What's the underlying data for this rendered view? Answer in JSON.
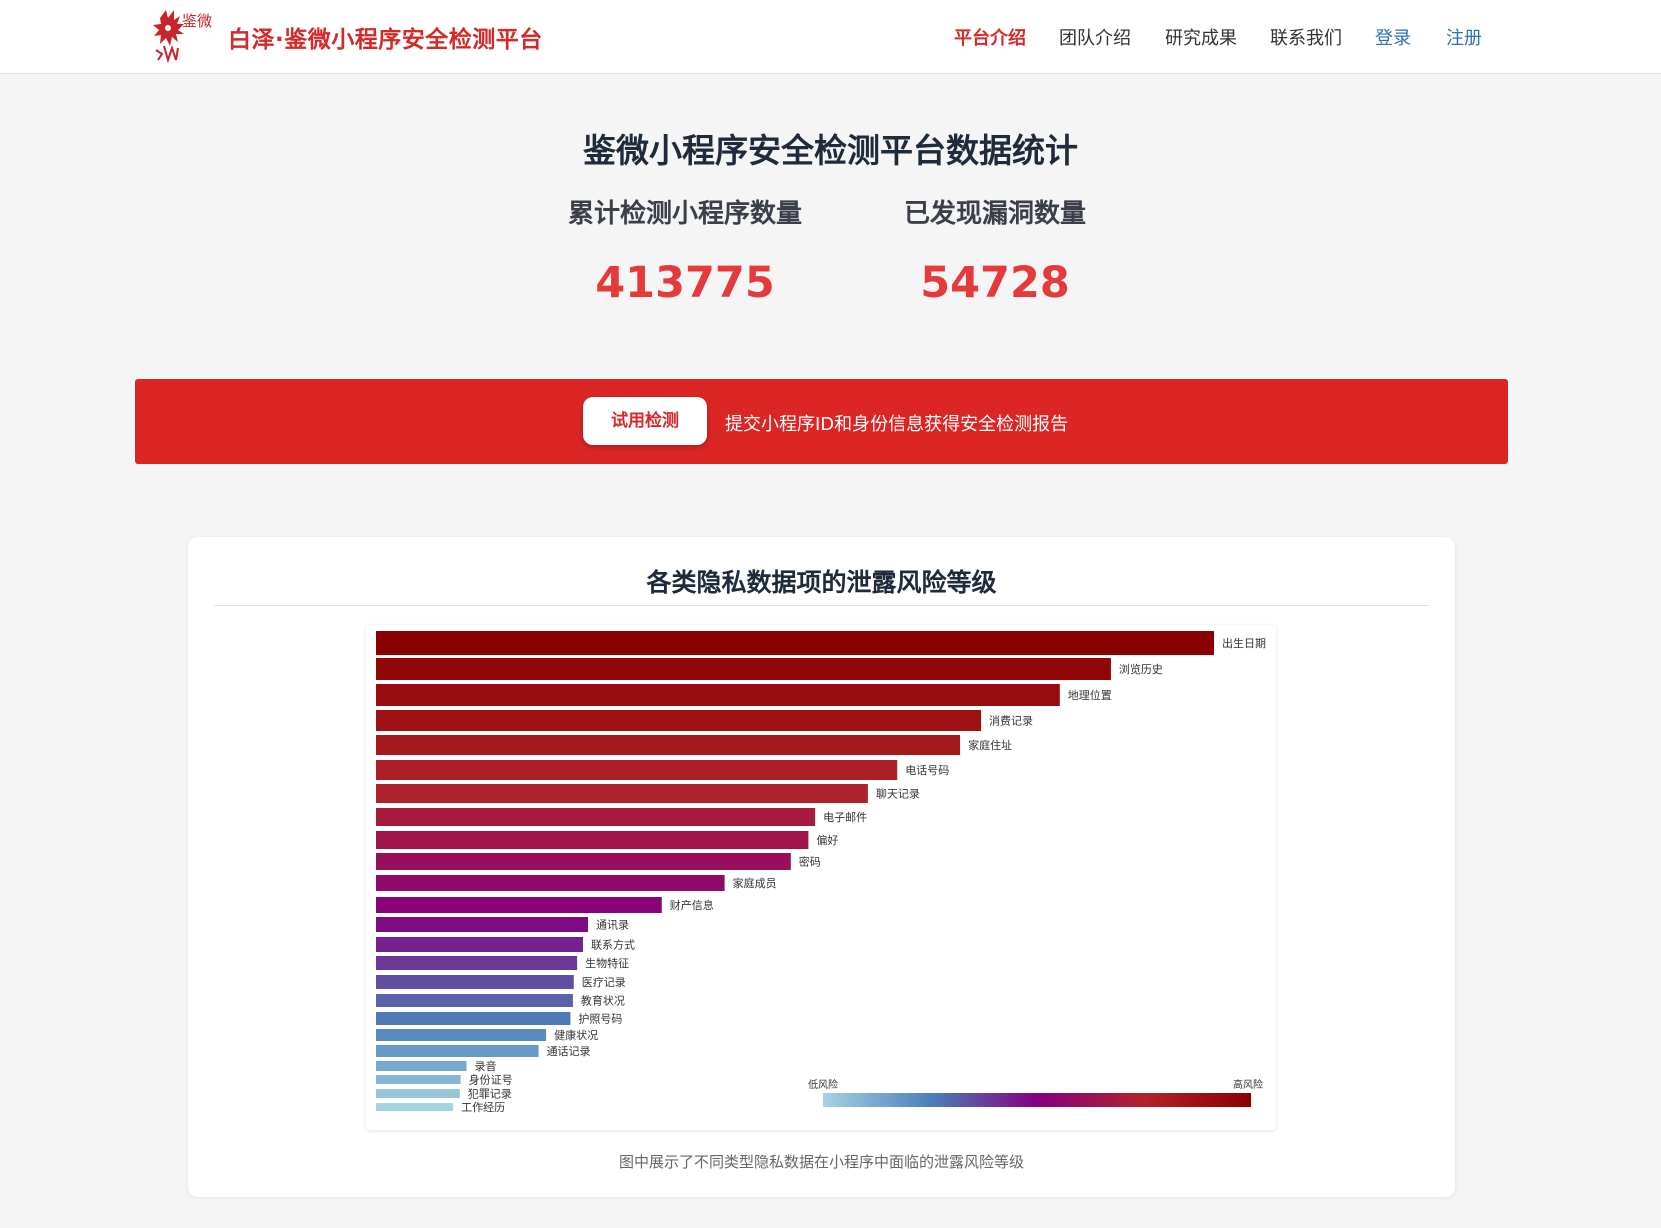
{
  "header": {
    "logo_text": "鉴微",
    "site_title": "白泽·鉴微小程序安全检测平台",
    "nav": {
      "intro": "平台介绍",
      "team": "团队介绍",
      "research": "研究成果",
      "contact": "联系我们",
      "login": "登录",
      "register": "注册"
    },
    "colors": {
      "brand": "#d42a2a",
      "link": "#2f6fb6"
    }
  },
  "stats": {
    "title": "鉴微小程序安全检测平台数据统计",
    "detected_label": "累计检测小程序数量",
    "detected_value": "413775",
    "vuln_label": "已发现漏洞数量",
    "vuln_value": "54728"
  },
  "banner": {
    "button_label": "试用检测",
    "text": "提交小程序ID和身份信息获得安全检测报告",
    "color": "#dc2626"
  },
  "chart_section": {
    "title": "各类隐私数据项的泄露风险等级",
    "caption": "图中展示了不同类型隐私数据在小程序中面临的泄露风险等级"
  },
  "chart_data": {
    "type": "bar",
    "orientation": "horizontal",
    "categories": [
      "出生日期",
      "浏览历史",
      "地理位置",
      "消费记录",
      "家庭住址",
      "电话号码",
      "聊天记录",
      "电子邮件",
      "偏好",
      "密码",
      "家庭成员",
      "财产信息",
      "通讯录",
      "联系方式",
      "生物特征",
      "医疗记录",
      "教育状况",
      "护照号码",
      "健康状况",
      "通话记录",
      "录音",
      "身份证号",
      "犯罪记录",
      "工作经历"
    ],
    "values": [
      100,
      87.7,
      81.6,
      72.2,
      69.7,
      62.2,
      58.7,
      52.4,
      51.6,
      49.5,
      41.6,
      34.1,
      25.3,
      24.7,
      24.0,
      23.6,
      23.5,
      23.2,
      20.3,
      19.4,
      10.8,
      10.1,
      10.0,
      9.2
    ],
    "xlim": [
      0,
      100
    ],
    "legend": {
      "low_label": "低风险",
      "high_label": "高风险",
      "placement": "bottom-right"
    },
    "colorscale": [
      "#a6d3e3",
      "#4a80b8",
      "#84007f",
      "#b0232a",
      "#8b0000"
    ]
  }
}
